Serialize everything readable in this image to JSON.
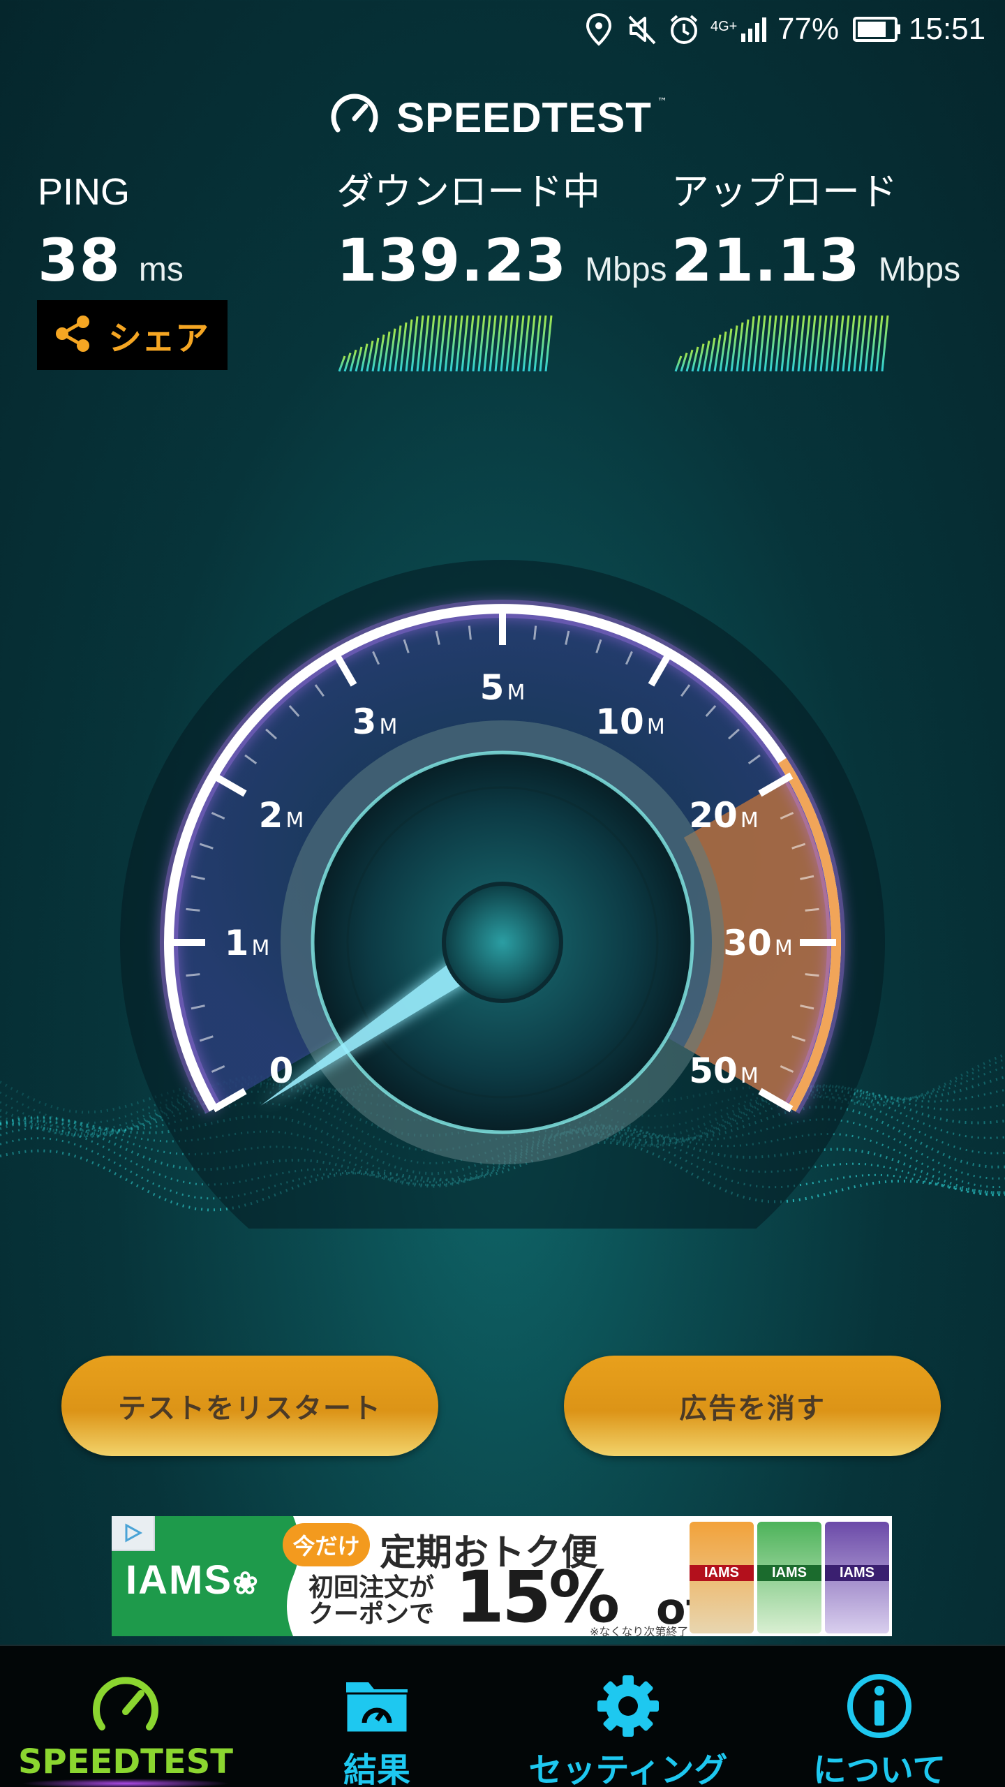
{
  "status_bar": {
    "network": "4G+",
    "battery": "77%",
    "time": "15:51"
  },
  "brand": {
    "title": "SPEEDTEST",
    "trademark": "™"
  },
  "metrics": {
    "ping": {
      "label": "PING",
      "value": "38",
      "unit": "ms"
    },
    "download": {
      "label": "ダウンロード中",
      "value": "139.23",
      "unit": "Mbps"
    },
    "upload": {
      "label": "アップロード",
      "value": "21.13",
      "unit": "Mbps"
    }
  },
  "share_button": {
    "label": "シェア"
  },
  "gauge": {
    "ticks": [
      {
        "num": "0",
        "unit": ""
      },
      {
        "num": "1",
        "unit": "M"
      },
      {
        "num": "2",
        "unit": "M"
      },
      {
        "num": "3",
        "unit": "M"
      },
      {
        "num": "5",
        "unit": "M"
      },
      {
        "num": "10",
        "unit": "M"
      },
      {
        "num": "20",
        "unit": "M"
      },
      {
        "num": "30",
        "unit": "M"
      },
      {
        "num": "50",
        "unit": "M"
      }
    ],
    "needle_value_mbps": 0,
    "colors": {
      "arc": "#ffffff",
      "glow": "#b97cff",
      "highlight": "#e8873a",
      "needle": "#8fe9f0"
    }
  },
  "buttons": {
    "restart": "テストをリスタート",
    "remove_ads": "広告を消す"
  },
  "ad": {
    "brand": "IAMS",
    "badge": "今だけ",
    "headline": "定期おトク便",
    "line1": "初回注文が",
    "line2": "クーポンで",
    "percent": "15%",
    "off": "off",
    "note": "※なくなり次第終了",
    "bag_label": "IAMS"
  },
  "nav": {
    "items": [
      {
        "label": "SPEEDTEST",
        "icon": "speedometer-icon",
        "active": true
      },
      {
        "label": "結果",
        "icon": "results-folder-icon",
        "active": false
      },
      {
        "label": "セッティング",
        "icon": "gear-icon",
        "active": false
      },
      {
        "label": "について",
        "icon": "info-icon",
        "active": false
      }
    ],
    "colors": {
      "active": "#8bd630",
      "inactive": "#1ec8f0"
    }
  }
}
